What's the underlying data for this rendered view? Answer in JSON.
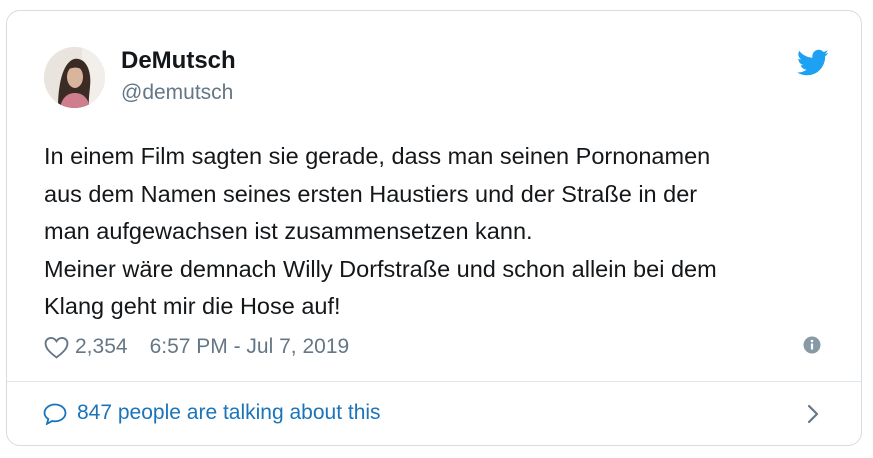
{
  "author": {
    "display_name": "DeMutsch",
    "handle": "@demutsch"
  },
  "tweet": {
    "lines": [
      "In einem Film sagten sie gerade, dass man seinen Pornonamen",
      "aus dem Namen seines ersten Haustiers und der Straße in der",
      "man aufgewachsen ist zusammensetzen kann.",
      "Meiner wäre demnach Willy Dorfstraße und schon allein bei dem",
      "Klang geht mir die Hose auf!"
    ]
  },
  "meta": {
    "likes": "2,354",
    "timestamp": "6:57 PM - Jul 7, 2019"
  },
  "footer": {
    "talking_label": "847 people are talking about this"
  },
  "icons": {
    "brand": "twitter-bird-icon",
    "like": "heart-outline-icon",
    "info": "info-icon",
    "conversation": "speech-bubble-icon",
    "more": "chevron-right-icon"
  },
  "colors": {
    "brand_blue": "#1da1f2",
    "link_blue": "#1b74b9",
    "text": "#14171a",
    "muted": "#657786",
    "border": "#d5dce2"
  }
}
